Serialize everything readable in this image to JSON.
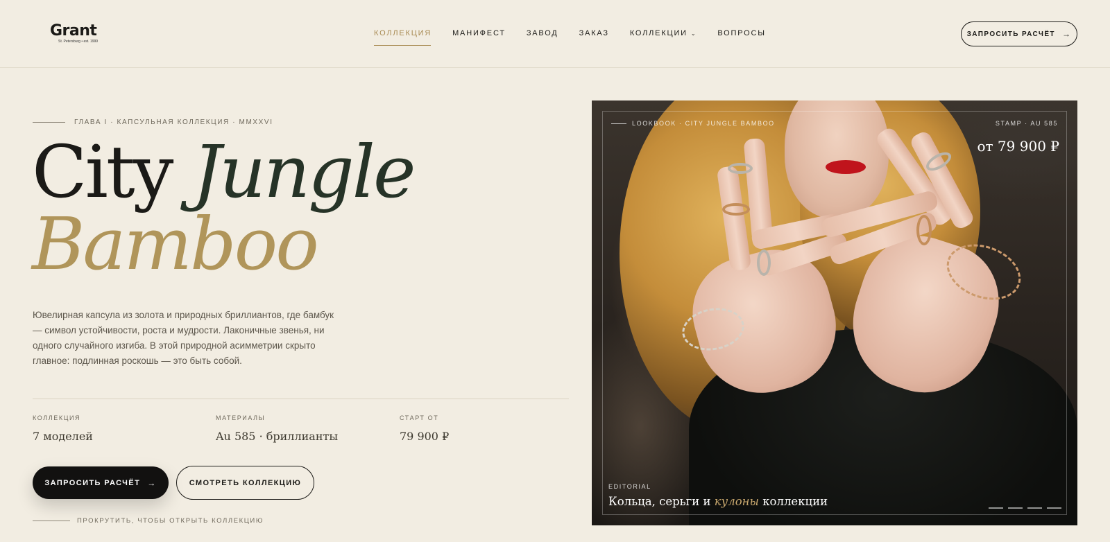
{
  "header": {
    "logo_word": "Grant",
    "logo_sub": "St. Petersburg • est. 1999",
    "nav": [
      {
        "label": "КОЛЛЕКЦИЯ"
      },
      {
        "label": "МАНИФЕСТ"
      },
      {
        "label": "ЗАВОД"
      },
      {
        "label": "ЗАКАЗ"
      },
      {
        "label": "КОЛЛЕКЦИИ"
      },
      {
        "label": "ВОПРОСЫ"
      }
    ],
    "active_nav": "КОЛЛЕКЦИЯ",
    "cta": "ЗАПРОСИТЬ РАСЧЁТ",
    "arrow": "→"
  },
  "hero": {
    "eyebrow": "ГЛАВА I · КАПСУЛЬНАЯ КОЛЛЕКЦИЯ · MMXXVI",
    "title_1": "City ",
    "title_2": "Jungle",
    "title_3": "Bamboo",
    "description": "Ювелирная капсула из золота и природных бриллиантов, где бамбук — символ устойчивости, роста и мудрости. Лаконичные звенья, ни одного случайного изгиба. В этой природной асимметрии скрыто главное: подлинная роскошь — это быть собой.",
    "stats": [
      {
        "label": "КОЛЛЕКЦИЯ",
        "value": "7 моделей"
      },
      {
        "label": "МАТЕРИАЛЫ",
        "value": "Au 585 · бриллианты"
      },
      {
        "label": "СТАРТ ОТ",
        "value": "79 900 ₽"
      }
    ],
    "primary_button": "ЗАПРОСИТЬ РАСЧЁТ",
    "secondary_button": "СМОТРЕТЬ КОЛЛЕКЦИЮ",
    "scroll_hint": "ПРОКРУТИТЬ, ЧТОБЫ ОТКРЫТЬ КОЛЛЕКЦИЮ"
  },
  "photo": {
    "label_left": "LOOKBOOK · CITY JUNGLE BAMBOO",
    "label_right": "STAMP · AU 585",
    "price": "от 79 900 ₽",
    "editorial": "EDITORIAL",
    "caption_1": "Кольца, серьги и ",
    "caption_accent": "кулоны",
    "caption_2": " коллекции",
    "slides": 4,
    "accent_color": "#c9a86e"
  },
  "colors": {
    "background": "#f2ede2",
    "gold": "#b0955a",
    "green": "#263327",
    "dark": "#121110"
  }
}
